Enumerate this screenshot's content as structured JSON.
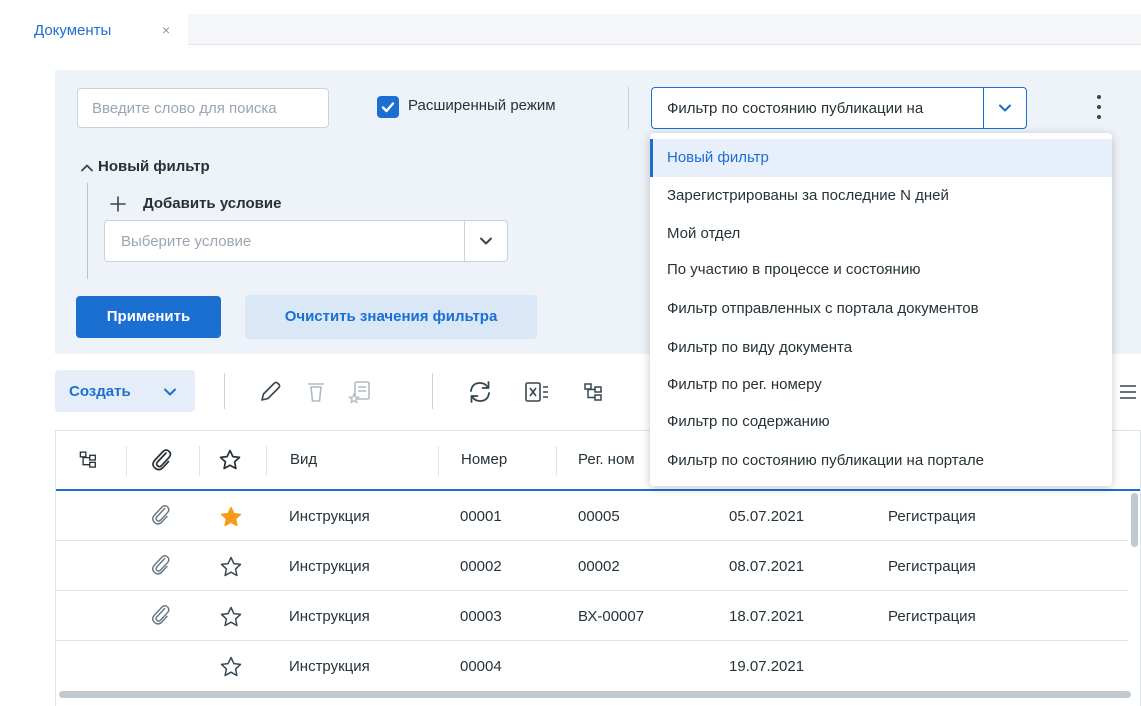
{
  "tabs": [
    {
      "label": "Документы",
      "close": "×"
    }
  ],
  "colors": {
    "accent": "#1b6fd1",
    "panel_bg": "#eef3f9",
    "star_fav": "#f79a1b"
  },
  "filter_panel": {
    "search_placeholder": "Введите слово для поиска",
    "extended_mode_label": "Расширенный режим",
    "extended_mode_checked": true,
    "filter_select_value": "Фильтр по состоянию публикации на",
    "tree_title": "Новый фильтр",
    "add_condition_label": "Добавить условие",
    "condition_placeholder": "Выберите условие",
    "apply_label": "Применить",
    "clear_label": "Очистить значения фильтра"
  },
  "filter_options": [
    "Новый фильтр",
    "Зарегистрированы за последние N дней",
    "Мой отдел",
    "По участию в процессе и состоянию",
    "Фильтр отправленных с портала документов",
    "Фильтр по виду документа",
    "Фильтр по рег. номеру",
    "Фильтр по содержанию",
    "Фильтр по состоянию публикации на портале"
  ],
  "filter_active_index": 0,
  "toolbar": {
    "create_label": "Создать",
    "icons": [
      "pencil-icon",
      "delete-icon",
      "favorite-doc-icon",
      "refresh-icon",
      "excel-export-icon",
      "hierarchy-icon",
      "list-settings-icon"
    ]
  },
  "grid": {
    "columns": [
      "Вид",
      "Номер",
      "Рег. ном"
    ],
    "header_icons": [
      "hierarchy-icon",
      "attachment-icon",
      "star-icon"
    ],
    "rows": [
      {
        "attachment": true,
        "favorite": true,
        "kind": "Инструкция",
        "number": "00001",
        "reg_number": "00005",
        "date": "05.07.2021",
        "stage": "Регистрация"
      },
      {
        "attachment": true,
        "favorite": false,
        "kind": "Инструкция",
        "number": "00002",
        "reg_number": "00002",
        "date": "08.07.2021",
        "stage": "Регистрация"
      },
      {
        "attachment": true,
        "favorite": false,
        "kind": "Инструкция",
        "number": "00003",
        "reg_number": "ВХ-00007",
        "date": "18.07.2021",
        "stage": "Регистрация"
      },
      {
        "attachment": false,
        "favorite": false,
        "kind": "Инструкция",
        "number": "00004",
        "reg_number": "",
        "date": "19.07.2021",
        "stage": ""
      }
    ]
  }
}
